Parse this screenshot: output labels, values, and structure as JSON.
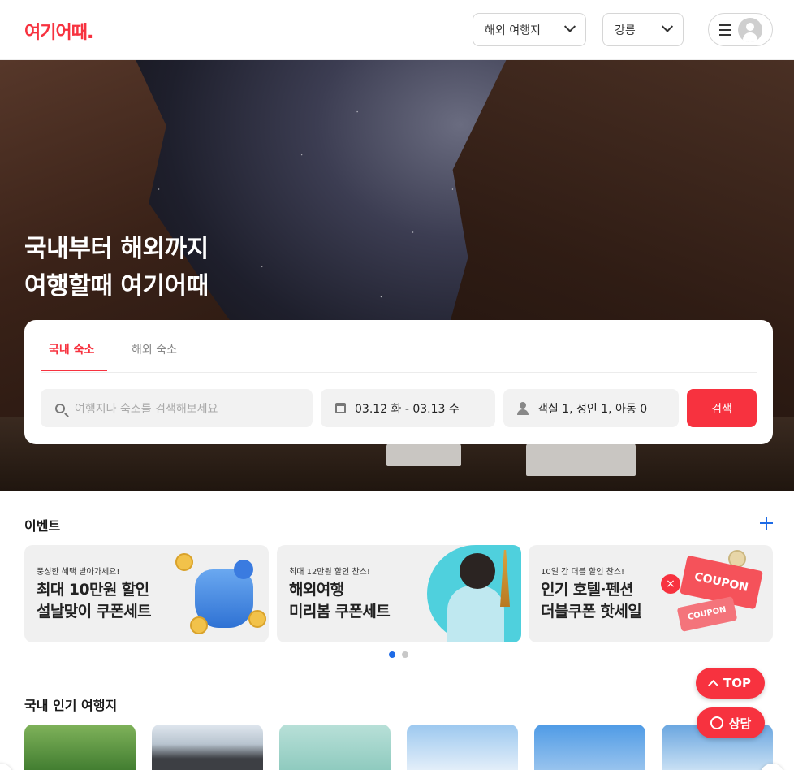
{
  "header": {
    "logo": "여기어때.",
    "region_select": "해외 여행지",
    "city_select": "강릉"
  },
  "hero": {
    "line1": "국내부터 해외까지",
    "line2": "여행할때 여기어때"
  },
  "search": {
    "tabs": [
      "국내 숙소",
      "해외 숙소"
    ],
    "active_tab": "국내 숙소",
    "query_placeholder": "여행지나 숙소를 검색해보세요",
    "date_range": "03.12 화 - 03.13 수",
    "guests": "객실 1, 성인 1, 아동 0",
    "submit_label": "검색"
  },
  "events": {
    "title": "이벤트",
    "items": [
      {
        "sub": "풍성한 혜택 받아가세요!",
        "line1": "최대 10만원 할인",
        "line2": "설날맞이 쿠폰세트"
      },
      {
        "sub": "최대 12만원 할인 찬스!",
        "line1": "해외여행",
        "line2": "미리봄 쿠폰세트"
      },
      {
        "sub": "10일 간 더블 할인 찬스!",
        "line1": "인기 호텔·펜션",
        "line2": "더블쿠폰 핫세일"
      }
    ],
    "coupon_text_1": "COUPON",
    "coupon_text_2": "COUPON",
    "page_current": 1,
    "page_total": 2
  },
  "popular": {
    "title": "국내 인기 여행지"
  },
  "floating": {
    "top_label": "TOP",
    "chat_label": "상담"
  },
  "colors": {
    "brand": "#f7323f",
    "accent_blue": "#1e6be6"
  }
}
